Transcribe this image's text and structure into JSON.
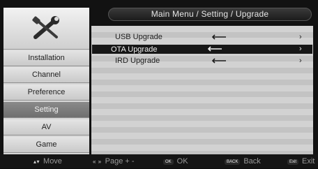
{
  "header": {
    "title": "Main Menu / Setting / Upgrade"
  },
  "logo": {
    "icon": "tools-icon"
  },
  "sidebar": {
    "items": [
      {
        "label": "Installation",
        "active": false
      },
      {
        "label": "Channel",
        "active": false
      },
      {
        "label": "Preference",
        "active": false
      },
      {
        "label": "Setting",
        "active": true
      },
      {
        "label": "AV",
        "active": false
      },
      {
        "label": "Game",
        "active": false
      }
    ]
  },
  "upgrade": {
    "options": [
      {
        "label": "USB Upgrade",
        "icon": "left-arrow-icon",
        "chevron": "›",
        "selected": false
      },
      {
        "label": "OTA Upgrade",
        "icon": "left-arrow-icon",
        "chevron": "›",
        "selected": true
      },
      {
        "label": "IRD Upgrade",
        "icon": "left-arrow-icon",
        "chevron": "›",
        "selected": false
      }
    ]
  },
  "footer": {
    "move": {
      "key": "▴▾",
      "label": "Move"
    },
    "page": {
      "key": "« »",
      "label": "Page + -"
    },
    "ok": {
      "key": "OK",
      "label": "OK"
    },
    "back": {
      "key": "BACK",
      "label": "Back"
    },
    "exit": {
      "key": "Exit",
      "label": "Exit"
    }
  },
  "colors": {
    "selected_row_bg": "#171717",
    "active_menu_bg": "#7c7c7c"
  }
}
